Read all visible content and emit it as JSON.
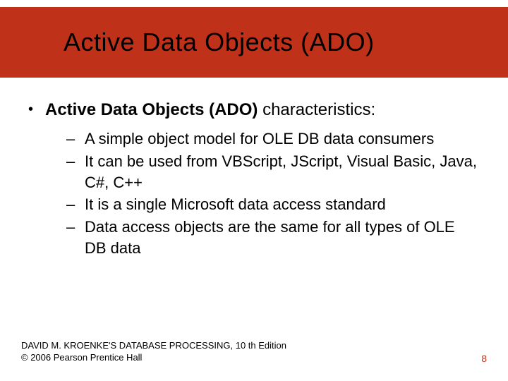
{
  "title": "Active Data Objects (ADO)",
  "body": {
    "lead_bold": "Active Data Objects (ADO)",
    "lead_rest": " characteristics:",
    "items": [
      "A simple object model for OLE DB data consumers",
      "It can be used from VBScript, JScript, Visual Basic, Java, C#, C++",
      "It is a single Microsoft data access standard",
      "Data access objects are the same for all types of OLE DB data"
    ]
  },
  "footer": {
    "line1": "DAVID M. KROENKE'S DATABASE PROCESSING, 10 th Edition",
    "line2": "© 2006 Pearson Prentice Hall",
    "page": "8"
  }
}
